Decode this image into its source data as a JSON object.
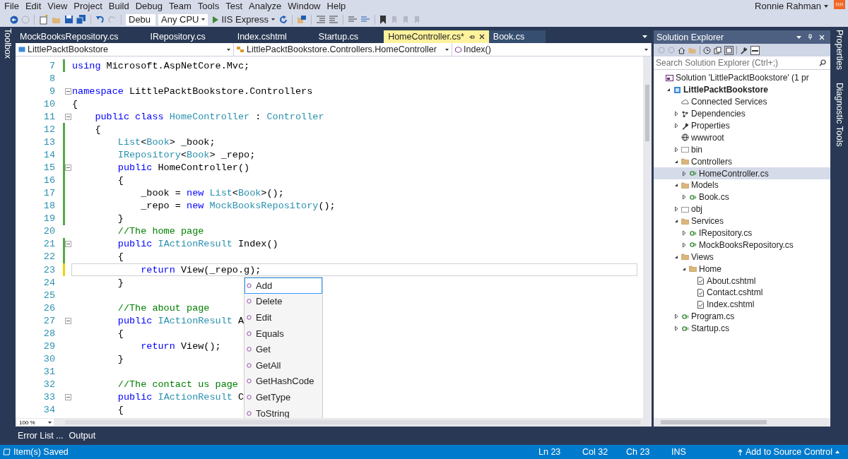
{
  "menu_bar": {
    "items": [
      "File",
      "Edit",
      "View",
      "Project",
      "Build",
      "Debug",
      "Team",
      "Tools",
      "Test",
      "Analyze",
      "Window",
      "Help"
    ],
    "user": "Ronnie Rahman",
    "avatar": "RR"
  },
  "toolbar": {
    "configuration": "Debu",
    "platform": "Any CPU",
    "run_target": "IIS Express"
  },
  "left_side_tabs": [
    "Toolbox"
  ],
  "editor": {
    "tabs": [
      {
        "label": "MockBooksRepository.cs",
        "selected": false
      },
      {
        "label": "IRepository.cs",
        "selected": false
      },
      {
        "label": "Index.cshtml",
        "selected": false
      },
      {
        "label": "Startup.cs",
        "selected": false
      },
      {
        "label": "HomeController.cs*",
        "selected": true
      },
      {
        "label": "Book.cs",
        "selected": false
      }
    ],
    "navigation": {
      "project": "LittlePacktBookstore",
      "type": "LittlePacktBookstore.Controllers.HomeController",
      "member": "Index()"
    },
    "lines": [
      {
        "number": "7",
        "color": "#57a64a",
        "fold": false,
        "current": false,
        "tokens": [
          {
            "kind": "keyword",
            "text": "using"
          },
          {
            "kind": "plain",
            "text": " Microsoft.AspNetCore.Mvc;"
          }
        ]
      },
      {
        "number": "8",
        "fold": false,
        "current": false
      },
      {
        "number": "9",
        "fold": true,
        "current": false,
        "tokens": [
          {
            "kind": "keyword",
            "text": "namespace"
          },
          {
            "kind": "plain",
            "text": " LittlePacktBookstore.Controllers"
          }
        ]
      },
      {
        "number": "10",
        "fold": false,
        "current": false,
        "tokens": [
          {
            "kind": "plain",
            "text": "{"
          }
        ]
      },
      {
        "number": "11",
        "fold": true,
        "current": false,
        "tokens": [
          {
            "kind": "keyword",
            "text": "    public class "
          },
          {
            "kind": "type",
            "text": "HomeController"
          },
          {
            "kind": "plain",
            "text": " : "
          },
          {
            "kind": "type",
            "text": "Controller"
          }
        ]
      },
      {
        "number": "12",
        "color": "#57a64a",
        "fold": false,
        "current": false,
        "tokens": [
          {
            "kind": "plain",
            "text": "    {"
          }
        ]
      },
      {
        "number": "13",
        "color": "#57a64a",
        "fold": false,
        "current": false,
        "tokens": [
          {
            "kind": "type",
            "text": "        List"
          },
          {
            "kind": "plain",
            "text": "<"
          },
          {
            "kind": "type",
            "text": "Book"
          },
          {
            "kind": "plain",
            "text": "> _book;"
          }
        ]
      },
      {
        "number": "14",
        "color": "#57a64a",
        "fold": false,
        "current": false,
        "tokens": [
          {
            "kind": "type",
            "text": "        IRepository"
          },
          {
            "kind": "plain",
            "text": "<"
          },
          {
            "kind": "type",
            "text": "Book"
          },
          {
            "kind": "plain",
            "text": "> _repo;"
          }
        ]
      },
      {
        "number": "15",
        "color": "#57a64a",
        "fold": true,
        "current": false,
        "tokens": [
          {
            "kind": "keyword",
            "text": "        public"
          },
          {
            "kind": "plain",
            "text": " HomeController()"
          }
        ]
      },
      {
        "number": "16",
        "color": "#57a64a",
        "fold": false,
        "current": false,
        "tokens": [
          {
            "kind": "plain",
            "text": "        {"
          }
        ]
      },
      {
        "number": "17",
        "color": "#57a64a",
        "fold": false,
        "current": false,
        "tokens": [
          {
            "kind": "plain",
            "text": "            _book = "
          },
          {
            "kind": "keyword",
            "text": "new "
          },
          {
            "kind": "type",
            "text": "List"
          },
          {
            "kind": "plain",
            "text": "<"
          },
          {
            "kind": "type",
            "text": "Book"
          },
          {
            "kind": "plain",
            "text": ">();"
          }
        ]
      },
      {
        "number": "18",
        "color": "#57a64a",
        "fold": false,
        "current": false,
        "tokens": [
          {
            "kind": "plain",
            "text": "            _repo = "
          },
          {
            "kind": "keyword",
            "text": "new "
          },
          {
            "kind": "type",
            "text": "MockBooksRepository"
          },
          {
            "kind": "plain",
            "text": "();"
          }
        ]
      },
      {
        "number": "19",
        "color": "#57a64a",
        "fold": false,
        "current": false,
        "tokens": [
          {
            "kind": "plain",
            "text": "        }"
          }
        ]
      },
      {
        "number": "20",
        "fold": false,
        "current": false,
        "tokens": [
          {
            "kind": "comment",
            "text": "        //The home page"
          }
        ]
      },
      {
        "number": "21",
        "color": "#57a64a",
        "fold": true,
        "current": false,
        "tokens": [
          {
            "kind": "keyword",
            "text": "        public "
          },
          {
            "kind": "type",
            "text": "IActionResult"
          },
          {
            "kind": "plain",
            "text": " Index()"
          }
        ]
      },
      {
        "number": "22",
        "color": "#57a64a",
        "fold": false,
        "current": false,
        "tokens": [
          {
            "kind": "plain",
            "text": "        {"
          }
        ]
      },
      {
        "number": "23",
        "color": "#efd200",
        "fold": false,
        "current": true,
        "tokens": [
          {
            "kind": "keyword",
            "text": "            return"
          },
          {
            "kind": "plain",
            "text": " View(_repo.g);"
          }
        ]
      },
      {
        "number": "24",
        "fold": false,
        "current": false,
        "tokens": [
          {
            "kind": "plain",
            "text": "        }"
          }
        ]
      },
      {
        "number": "25",
        "fold": false,
        "current": false
      },
      {
        "number": "26",
        "fold": false,
        "current": false,
        "tokens": [
          {
            "kind": "comment",
            "text": "        //The about page"
          }
        ]
      },
      {
        "number": "27",
        "fold": true,
        "current": false,
        "tokens": [
          {
            "kind": "keyword",
            "text": "        public "
          },
          {
            "kind": "type",
            "text": "IActionResult"
          },
          {
            "kind": "plain",
            "text": " A"
          }
        ]
      },
      {
        "number": "28",
        "fold": false,
        "current": false,
        "tokens": [
          {
            "kind": "plain",
            "text": "        {"
          }
        ]
      },
      {
        "number": "29",
        "fold": false,
        "current": false,
        "tokens": [
          {
            "kind": "keyword",
            "text": "            return"
          },
          {
            "kind": "plain",
            "text": " View();"
          }
        ]
      },
      {
        "number": "30",
        "fold": false,
        "current": false,
        "tokens": [
          {
            "kind": "plain",
            "text": "        }"
          }
        ]
      },
      {
        "number": "31",
        "fold": false,
        "current": false
      },
      {
        "number": "32",
        "fold": false,
        "current": false,
        "tokens": [
          {
            "kind": "comment",
            "text": "        //The contact us page"
          }
        ]
      },
      {
        "number": "33",
        "fold": true,
        "current": false,
        "tokens": [
          {
            "kind": "keyword",
            "text": "        public "
          },
          {
            "kind": "type",
            "text": "IActionResult"
          },
          {
            "kind": "plain",
            "text": " C"
          }
        ]
      },
      {
        "number": "34",
        "fold": false,
        "current": false,
        "tokens": [
          {
            "kind": "plain",
            "text": "        {"
          }
        ]
      }
    ],
    "completion": [
      {
        "label": "Add",
        "selected": true
      },
      {
        "label": "Delete",
        "selected": false
      },
      {
        "label": "Edit",
        "selected": false
      },
      {
        "label": "Equals",
        "selected": false
      },
      {
        "label": "Get",
        "selected": false
      },
      {
        "label": "GetAll",
        "selected": false
      },
      {
        "label": "GetHashCode",
        "selected": false
      },
      {
        "label": "GetType",
        "selected": false
      },
      {
        "label": "ToString",
        "selected": false
      }
    ],
    "zoom": "100 %"
  },
  "solution_explorer": {
    "title": "Solution Explorer",
    "search_placeholder": "Search Solution Explorer (Ctrl+;)",
    "tree": [
      {
        "label": "Solution 'LittlePacktBookstore' (1 pr",
        "kind": "solution",
        "selected": false,
        "children": [
          {
            "label": "LittlePacktBookstore",
            "kind": "project",
            "expanded": true,
            "selected": false,
            "children": [
              {
                "label": "Connected Services",
                "kind": "service",
                "selected": false
              },
              {
                "label": "Dependencies",
                "kind": "dependencies",
                "expanded": false,
                "selected": false
              },
              {
                "label": "Properties",
                "kind": "properties",
                "expanded": false,
                "selected": false
              },
              {
                "label": "wwwroot",
                "kind": "globe",
                "selected": false
              },
              {
                "label": "bin",
                "kind": "excluded-folder",
                "expanded": false,
                "selected": false
              },
              {
                "label": "Controllers",
                "kind": "folder",
                "expanded": true,
                "selected": false,
                "children": [
                  {
                    "label": "HomeController.cs",
                    "kind": "cs",
                    "expanded": false,
                    "selected": true
                  }
                ]
              },
              {
                "label": "Models",
                "kind": "folder",
                "expanded": true,
                "selected": false,
                "children": [
                  {
                    "label": "Book.cs",
                    "kind": "cs",
                    "expanded": false,
                    "selected": false
                  }
                ]
              },
              {
                "label": "obj",
                "kind": "excluded-folder",
                "expanded": false,
                "selected": false
              },
              {
                "label": "Services",
                "kind": "folder",
                "expanded": true,
                "selected": false,
                "children": [
                  {
                    "label": "IRepository.cs",
                    "kind": "cs",
                    "expanded": false,
                    "selected": false
                  },
                  {
                    "label": "MockBooksRepository.cs",
                    "kind": "cs",
                    "expanded": false,
                    "selected": false
                  }
                ]
              },
              {
                "label": "Views",
                "kind": "folder",
                "expanded": true,
                "selected": false,
                "children": [
                  {
                    "label": "Home",
                    "kind": "folder",
                    "expanded": true,
                    "selected": false,
                    "children": [
                      {
                        "label": "About.cshtml",
                        "kind": "page",
                        "selected": false
                      },
                      {
                        "label": "Contact.cshtml",
                        "kind": "page",
                        "selected": false
                      },
                      {
                        "label": "Index.cshtml",
                        "kind": "page",
                        "selected": false
                      }
                    ]
                  }
                ]
              },
              {
                "label": "Program.cs",
                "kind": "cs",
                "expanded": false,
                "selected": false
              },
              {
                "label": "Startup.cs",
                "kind": "cs",
                "expanded": false,
                "selected": false
              }
            ]
          }
        ]
      }
    ]
  },
  "right_side_tabs": [
    "Properties",
    "Diagnostic Tools"
  ],
  "bottom_tabs": [
    "Error List ...",
    "Output"
  ],
  "status_bar": {
    "message": "Item(s) Saved",
    "line": "Ln 23",
    "column": "Col 32",
    "char": "Ch 23",
    "mode": "INS",
    "source_control": "Add to Source Control"
  }
}
